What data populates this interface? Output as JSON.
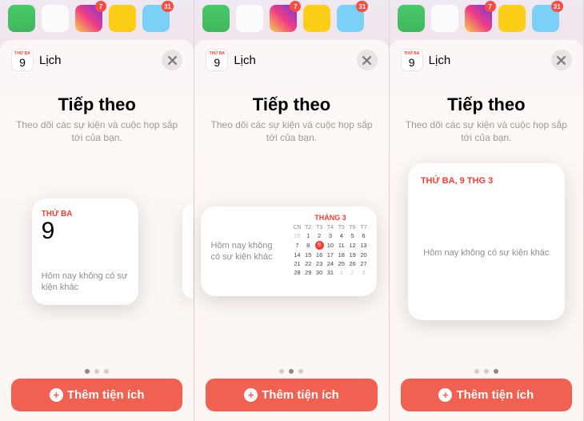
{
  "app": {
    "icon_day_label": "THỨ BA",
    "icon_day_num": "9",
    "title": "Lịch",
    "badges": {
      "seven": "7",
      "thirtyone": "31"
    }
  },
  "sheet": {
    "heading": "Tiếp theo",
    "sub": "Theo dõi các sự kiện và cuộc họp sắp tới của bạn."
  },
  "widget_small": {
    "day_label": "THỨ BA",
    "day_num": "9",
    "no_events": "Hôm nay không có sự kiện khác"
  },
  "widget_medium": {
    "no_events": "Hôm nay không có sự kiện khác",
    "month": "THÁNG 3",
    "dow": [
      "CN",
      "T2",
      "T3",
      "T4",
      "T5",
      "T6",
      "T7"
    ],
    "rows": [
      [
        "28",
        "1",
        "2",
        "3",
        "4",
        "5",
        "6"
      ],
      [
        "7",
        "8",
        "9",
        "10",
        "11",
        "12",
        "13"
      ],
      [
        "14",
        "15",
        "16",
        "17",
        "18",
        "19",
        "20"
      ],
      [
        "21",
        "22",
        "23",
        "24",
        "25",
        "26",
        "27"
      ],
      [
        "28",
        "29",
        "30",
        "31",
        "1",
        "2",
        "3"
      ]
    ],
    "today": "9"
  },
  "widget_large": {
    "date": "THỨ BA, 9 THG 3",
    "no_events": "Hôm nay không có sự kiện khác"
  },
  "add_button": "Thêm tiện ích"
}
